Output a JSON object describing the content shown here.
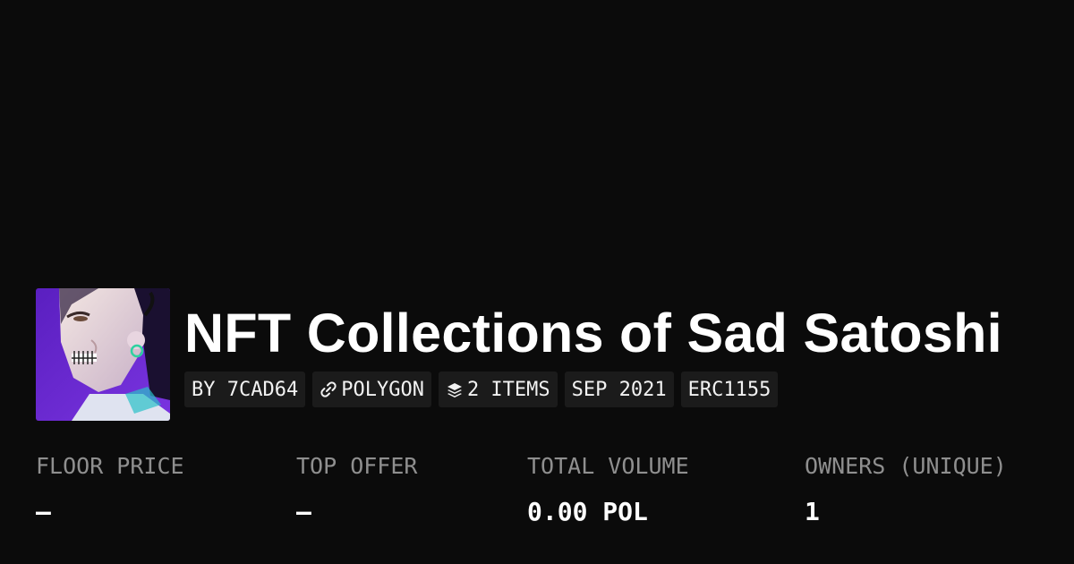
{
  "collection": {
    "title": "NFT Collections of Sad Satoshi",
    "image_icon": "collection-avatar-image"
  },
  "tags": {
    "creator": "BY 7CAD64",
    "chain": "POLYGON",
    "chain_icon": "chain-link-icon",
    "items": "2 ITEMS",
    "items_icon": "layers-icon",
    "date": "SEP 2021",
    "standard": "ERC1155"
  },
  "stats": {
    "floor_price": {
      "label": "FLOOR PRICE",
      "value": "—"
    },
    "top_offer": {
      "label": "TOP OFFER",
      "value": "—"
    },
    "total_volume": {
      "label": "TOTAL VOLUME",
      "value": "0.00 POL"
    },
    "owners": {
      "label": "OWNERS (UNIQUE)",
      "value": "1"
    }
  },
  "colors": {
    "background": "#0b0b0b",
    "tag_background": "#1b1b1b",
    "label_gray": "#8f8f8f",
    "text_white": "#ffffff",
    "artwork_purple": "#6a2bd1"
  }
}
